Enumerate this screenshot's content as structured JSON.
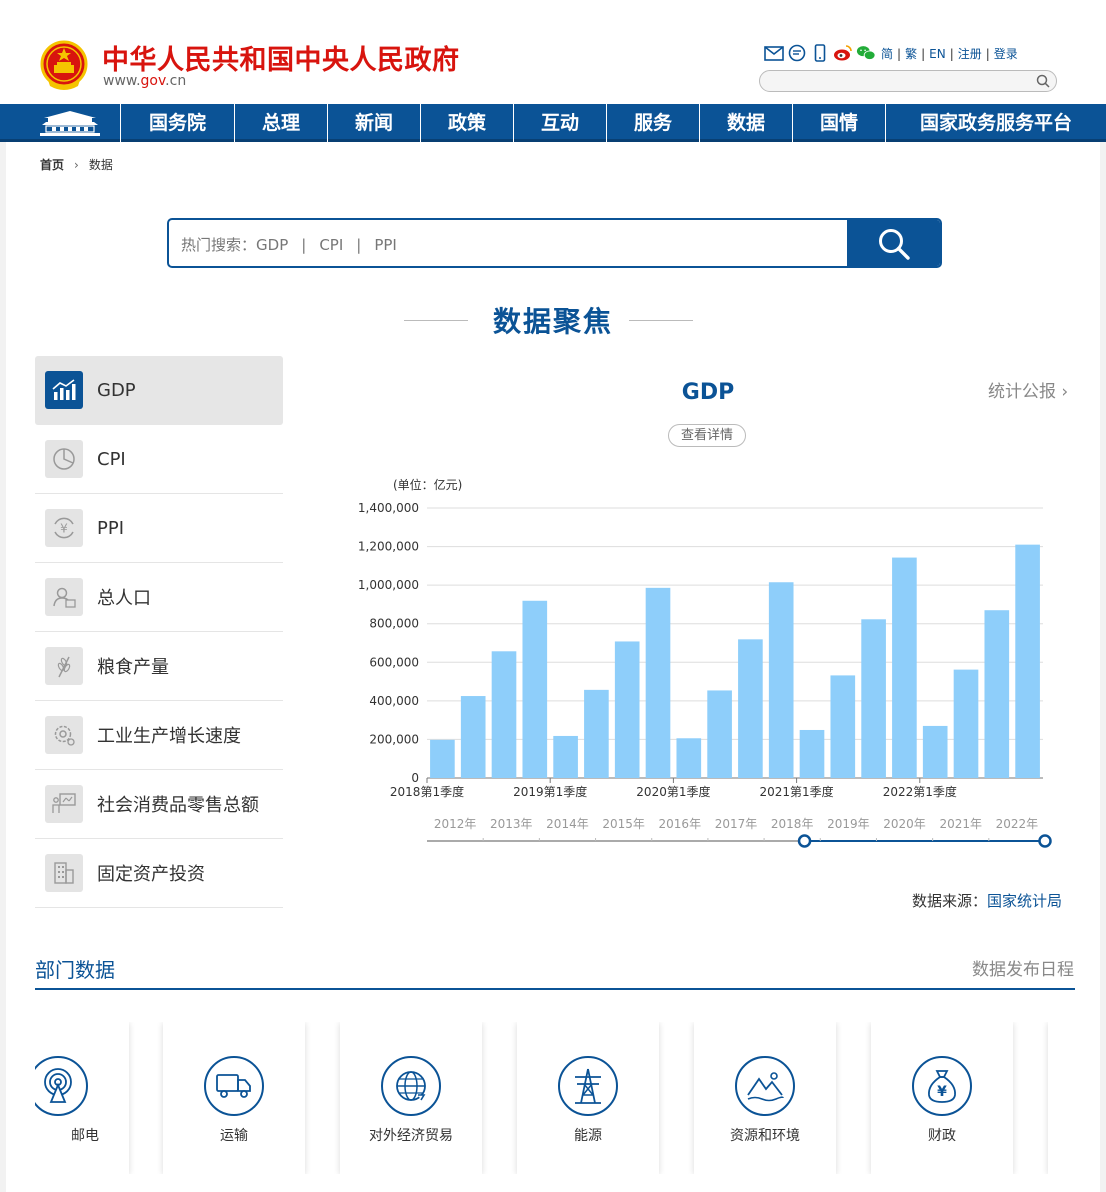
{
  "header": {
    "title": "中华人民共和国中央人民政府",
    "url_prefix": "www.",
    "url_gov": "gov",
    "url_suffix": ".cn",
    "lang_links": [
      "简",
      "繁",
      "EN",
      "注册",
      "登录"
    ]
  },
  "nav": {
    "items": [
      "国务院",
      "总理",
      "新闻",
      "政策",
      "互动",
      "服务",
      "数据",
      "国情",
      "国家政务服务平台"
    ]
  },
  "breadcrumb": {
    "home": "首页",
    "arrow": "›",
    "current": "数据"
  },
  "search": {
    "hint_label": "热门搜索：",
    "hot_terms": [
      "GDP",
      "CPI",
      "PPI"
    ],
    "separator": "|"
  },
  "section": {
    "title": "数据聚焦"
  },
  "menu": {
    "items": [
      {
        "label": "GDP",
        "icon": "bar-chart-icon",
        "active": true
      },
      {
        "label": "CPI",
        "icon": "pie-chart-icon",
        "active": false
      },
      {
        "label": "PPI",
        "icon": "yuan-cycle-icon",
        "active": false
      },
      {
        "label": "总人口",
        "icon": "person-card-icon",
        "active": false
      },
      {
        "label": "粮食产量",
        "icon": "wheat-icon",
        "active": false
      },
      {
        "label": "工业生产增长速度",
        "icon": "gear-icon",
        "active": false
      },
      {
        "label": "社会消费品零售总额",
        "icon": "presentation-icon",
        "active": false
      },
      {
        "label": "固定资产投资",
        "icon": "building-icon",
        "active": false
      }
    ]
  },
  "chart_panel": {
    "title": "GDP",
    "detail_button": "查看详情",
    "stat_link": "统计公报",
    "source_label": "数据来源：",
    "source_org": "国家统计局"
  },
  "chart_data": {
    "type": "bar",
    "unit_label": "(单位：亿元)",
    "ylim": [
      0,
      1400000
    ],
    "yticks": [
      0,
      200000,
      400000,
      600000,
      800000,
      1000000,
      1200000,
      1400000
    ],
    "ytick_labels": [
      "0",
      "200,000",
      "400,000",
      "600,000",
      "800,000",
      "1,000,000",
      "1,200,000",
      "1,400,000"
    ],
    "categories": [
      "2018Q1",
      "2018Q2",
      "2018Q3",
      "2018Q4",
      "2019Q1",
      "2019Q2",
      "2019Q3",
      "2019Q4",
      "2020Q1",
      "2020Q2",
      "2020Q3",
      "2020Q4",
      "2021Q1",
      "2021Q2",
      "2021Q3",
      "2021Q4",
      "2022Q1",
      "2022Q2",
      "2022Q3",
      "2022Q4"
    ],
    "values": [
      198000,
      425000,
      657000,
      919000,
      218000,
      457000,
      708000,
      986000,
      206000,
      454000,
      719000,
      1015000,
      249000,
      532000,
      823000,
      1143000,
      270000,
      562000,
      870000,
      1210000
    ],
    "xtick_labels": [
      {
        "index": 0,
        "label": "2018第1季度"
      },
      {
        "index": 4,
        "label": "2019第1季度"
      },
      {
        "index": 8,
        "label": "2020第1季度"
      },
      {
        "index": 12,
        "label": "2021第1季度"
      },
      {
        "index": 16,
        "label": "2022第1季度"
      }
    ],
    "bar_color": "#8ecefa",
    "grid": true
  },
  "timeline": {
    "years": [
      "2012年",
      "2013年",
      "2014年",
      "2015年",
      "2016年",
      "2017年",
      "2018年",
      "2019年",
      "2020年",
      "2021年",
      "2022年"
    ],
    "range_start": "2018年",
    "range_end": "2022年",
    "accent": "#0b5396"
  },
  "dept": {
    "title": "部门数据",
    "link": "数据发布日程",
    "cards": [
      {
        "label": "邮电",
        "icon": "signal-tower-icon"
      },
      {
        "label": "运输",
        "icon": "truck-icon"
      },
      {
        "label": "对外经济贸易",
        "icon": "globe-trade-icon"
      },
      {
        "label": "能源",
        "icon": "power-pylon-icon"
      },
      {
        "label": "资源和环境",
        "icon": "mountain-icon"
      },
      {
        "label": "财政",
        "icon": "money-bag-icon"
      }
    ]
  },
  "colors": {
    "brand_blue": "#0b5396",
    "brand_red": "#d8140e"
  }
}
